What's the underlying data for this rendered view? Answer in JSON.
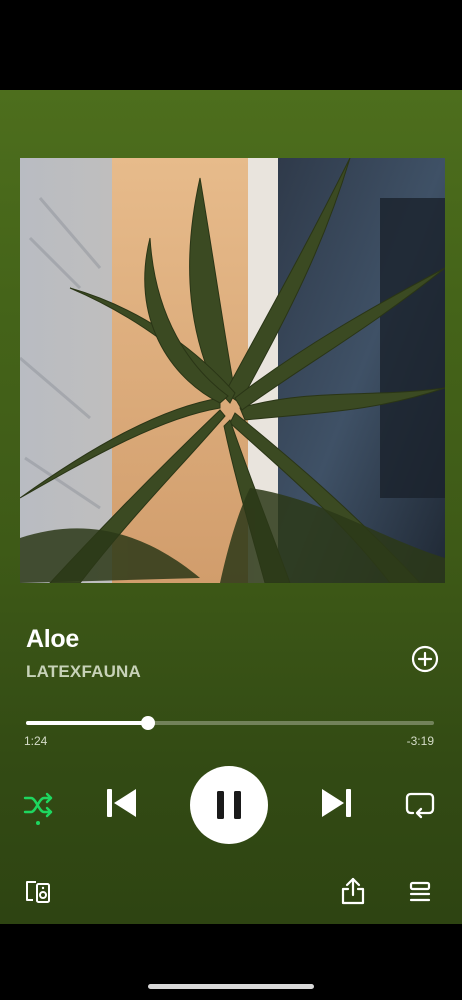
{
  "track": {
    "title": "Aloe",
    "artist": "LATEXFAUNA"
  },
  "playback": {
    "elapsed": "1:24",
    "remaining": "-3:19",
    "progress_fraction": 0.3,
    "is_playing": true,
    "shuffle_on": true
  },
  "icons": {
    "add": "plus-circle-icon",
    "shuffle": "shuffle-icon",
    "previous": "skip-previous-icon",
    "pause": "pause-icon",
    "next": "skip-next-icon",
    "repeat": "repeat-icon",
    "devices": "connect-device-icon",
    "share": "share-icon",
    "queue": "queue-icon"
  },
  "colors": {
    "background_top": "#4d6e1d",
    "background_bottom": "#2e4412",
    "accent_active": "#1ed760",
    "text_primary": "#ffffff"
  }
}
